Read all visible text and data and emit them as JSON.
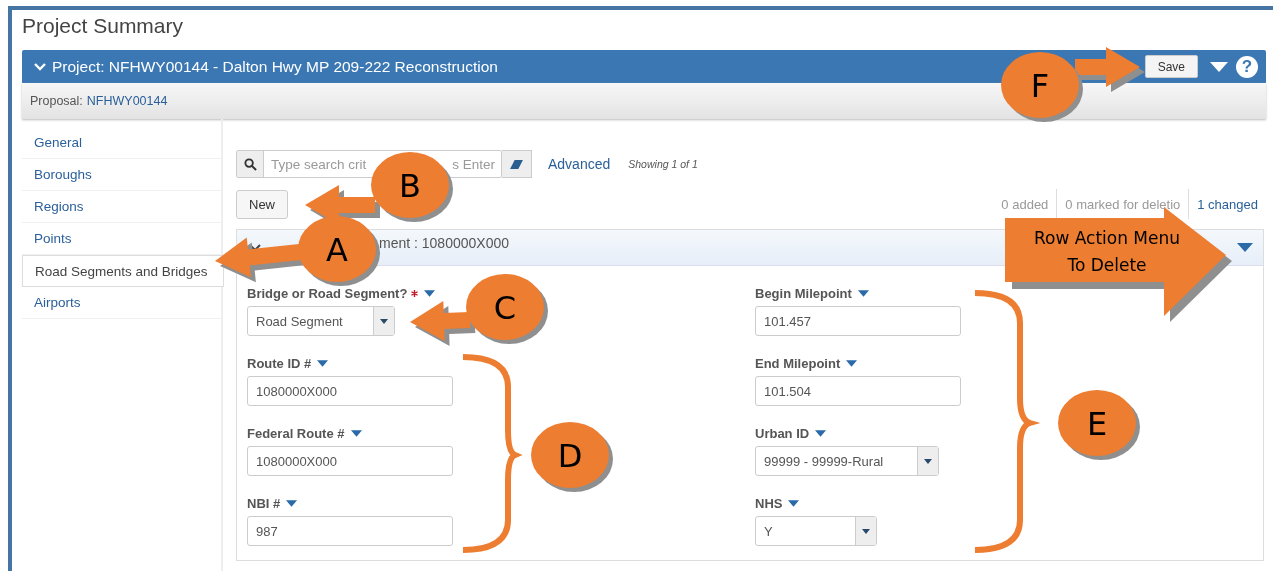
{
  "page_title": "Project Summary",
  "project_header": {
    "title": "Project: NFHWY00144 - Dalton Hwy MP 209-222 Reconstruction",
    "save_button": "Save",
    "help_glyph": "?"
  },
  "proposal": {
    "label": "Proposal:",
    "value": "NFHWY00144"
  },
  "sidebar": {
    "items": [
      {
        "label": "General",
        "selected": false
      },
      {
        "label": "Boroughs",
        "selected": false
      },
      {
        "label": "Regions",
        "selected": false
      },
      {
        "label": "Points",
        "selected": false
      },
      {
        "label": "Road Segments and Bridges",
        "selected": true
      },
      {
        "label": "Airports",
        "selected": false
      }
    ]
  },
  "search": {
    "placeholder": "Type search crit",
    "placeholder_tail": "s Enter",
    "advanced_link": "Advanced",
    "showing": "Showing 1 of 1"
  },
  "new_button": "New",
  "counters": [
    {
      "text": "0 added",
      "kind": "muted"
    },
    {
      "text": "0 marked for deletio",
      "kind": "muted"
    },
    {
      "text": "1 changed",
      "kind": "link"
    }
  ],
  "segment": {
    "header": "ment : 1080000X000",
    "left_fields": [
      {
        "label": "Bridge or Road Segment?",
        "required": true,
        "kind": "select",
        "value": "Road Segment"
      },
      {
        "label": "Route ID #",
        "required": false,
        "kind": "text",
        "value": "1080000X000"
      },
      {
        "label": "Federal Route #",
        "required": false,
        "kind": "text",
        "value": "1080000X000"
      },
      {
        "label": "NBI #",
        "required": false,
        "kind": "text",
        "value": "987"
      }
    ],
    "right_fields": [
      {
        "label": "Begin Milepoint",
        "required": false,
        "kind": "text",
        "value": "101.457"
      },
      {
        "label": "End Milepoint",
        "required": false,
        "kind": "text",
        "value": "101.504"
      },
      {
        "label": "Urban ID",
        "required": false,
        "kind": "select",
        "value": "99999 - 99999-Rural"
      },
      {
        "label": "NHS",
        "required": false,
        "kind": "select",
        "value": "Y"
      }
    ]
  },
  "annotations": [
    {
      "kind": "callout",
      "letter": "F"
    },
    {
      "kind": "callout",
      "letter": "B"
    },
    {
      "kind": "callout",
      "letter": "A"
    },
    {
      "kind": "callout",
      "letter": "C"
    },
    {
      "kind": "callout",
      "letter": "D"
    },
    {
      "kind": "callout",
      "letter": "E"
    },
    {
      "kind": "big-arrow",
      "lines": [
        "Row Action Menu",
        "To Delete"
      ]
    }
  ]
}
